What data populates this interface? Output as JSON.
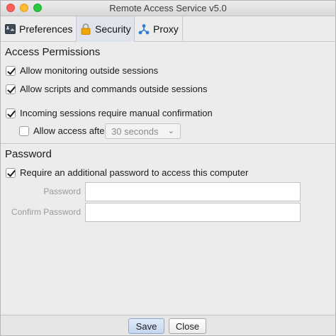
{
  "window": {
    "title": "Remote Access Service v5.0"
  },
  "tabs": [
    {
      "label": "Preferences",
      "icon": "preferences-icon"
    },
    {
      "label": "Security",
      "icon": "lock-icon",
      "active": true
    },
    {
      "label": "Proxy",
      "icon": "proxy-network-icon"
    }
  ],
  "access_permissions": {
    "title": "Access Permissions",
    "allow_monitoring": {
      "label": "Allow monitoring outside sessions",
      "checked": true
    },
    "allow_scripts": {
      "label": "Allow scripts and commands outside sessions",
      "checked": true
    },
    "manual_confirmation": {
      "label": "Incoming sessions require manual confirmation",
      "checked": true
    },
    "allow_access_after": {
      "label": "Allow access after",
      "checked": false,
      "selected": "30 seconds"
    }
  },
  "password": {
    "title": "Password",
    "require_password": {
      "label": "Require an additional password to access this computer",
      "checked": true
    },
    "password_label": "Password",
    "confirm_label": "Confirm Password",
    "password_value": "",
    "confirm_value": ""
  },
  "buttons": {
    "save": "Save",
    "close": "Close"
  },
  "colors": {
    "active_tab": "#dfe4ec",
    "primary_button": "#c4d7f0",
    "window_bg": "#ececec"
  }
}
